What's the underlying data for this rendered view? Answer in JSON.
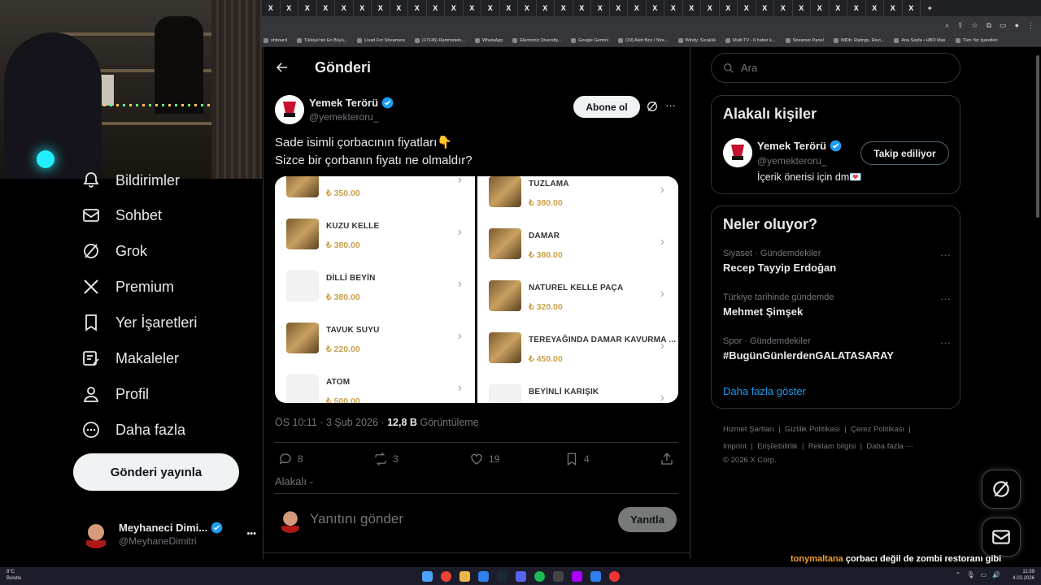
{
  "browser": {
    "tab_glyph": "X",
    "new_tab": "+",
    "bookmarks": [
      "shboard",
      "Türkiye'nin En Büyü...",
      "Livad For Streamers",
      "(17145) Rammstein...",
      "WhatsApp",
      "Electronic Diversity...",
      "Google Gemini",
      "(19) Alert Box / Stre...",
      "Windy: Sıcaklık",
      "Multi TV - 6 haber k...",
      "Streamer Panel",
      "IMDb: Ratings, Revi...",
      "Ana Sayfa • HBO Max",
      "Tüm Yer İşaretleri"
    ]
  },
  "nav": {
    "items": [
      {
        "label": "Bildirimler",
        "icon": "bell-icon"
      },
      {
        "label": "Sohbet",
        "icon": "mail-icon"
      },
      {
        "label": "Grok",
        "icon": "grok-icon"
      },
      {
        "label": "Premium",
        "icon": "x-logo-icon"
      },
      {
        "label": "Yer İşaretleri",
        "icon": "bookmark-icon"
      },
      {
        "label": "Makaleler",
        "icon": "article-icon"
      },
      {
        "label": "Profil",
        "icon": "profile-icon"
      },
      {
        "label": "Daha fazla",
        "icon": "more-circle-icon"
      }
    ],
    "post_button": "Gönderi yayınla",
    "account": {
      "name": "Meyhaneci Dimi...",
      "handle": "@MeyhaneDimitri",
      "more": "•••"
    }
  },
  "post": {
    "header_title": "Gönderi",
    "author_name": "Yemek Terörü",
    "author_handle": "@yemekteroru_",
    "subscribe": "Abone ol",
    "text_line1": "Sade isimli çorbacının fiyatları👇",
    "text_line2": "Sizce bir çorbanın fiyatı ne olmaldır?",
    "menu_left": [
      {
        "name": "",
        "price": "₺ 350.00",
        "img": true
      },
      {
        "name": "KUZU KELLE",
        "price": "₺ 380.00",
        "img": true
      },
      {
        "name": "DİLLİ BEYİN",
        "price": "₺ 380.00",
        "img": false
      },
      {
        "name": "TAVUK SUYU",
        "price": "₺ 220.00",
        "img": true
      },
      {
        "name": "ATOM",
        "price": "₺ 500.00",
        "img": false
      }
    ],
    "menu_right": [
      {
        "name": "TUZLAMA",
        "price": "₺ 380.00",
        "img": true
      },
      {
        "name": "DAMAR",
        "price": "₺ 380.00",
        "img": true
      },
      {
        "name": "NATUREL KELLE PAÇA",
        "price": "₺ 320.00",
        "img": true
      },
      {
        "name": "TEREYAĞINDA DAMAR KAVURMA ...",
        "price": "₺ 450.00",
        "img": true
      },
      {
        "name": "BEYİNLİ KARIŞIK",
        "price": "",
        "img": false
      }
    ],
    "timestamp": "ÖS 10:11 · 3 Şub 2026 · ",
    "views_count": "12,8 B",
    "views_label": " Görüntüleme",
    "replies": "8",
    "reposts": "3",
    "likes": "19",
    "bookmarks": "4",
    "relevance": "Alakalı",
    "reply_placeholder": "Yanıtını gönder",
    "reply_button": "Yanıtla"
  },
  "sidebar": {
    "search_placeholder": "Ara",
    "related_title": "Alakalı kişiler",
    "related": {
      "name": "Yemek Terörü",
      "handle": "@yemekteroru_",
      "bio": "İçerik önerisi için dm💌",
      "follow_button": "Takip ediliyor"
    },
    "trends_title": "Neler oluyor?",
    "trends": [
      {
        "context": "Siyaset · Gündemdekiler",
        "name": "Recep Tayyip Erdoğan"
      },
      {
        "context": "Türkiye tarihinde gündemde",
        "name": "Mehmet Şimşek"
      },
      {
        "context": "Spor · Gündemdekiler",
        "name": "#BugünGünlerdenGALATASARAY"
      }
    ],
    "show_more": "Daha fazla göster",
    "footer_row1": [
      "Hizmet Şartları",
      "Gizlilik Politikası",
      "Çerez Politikası"
    ],
    "footer_row2": [
      "Imprint",
      "Erişilebilirlik",
      "Reklam bilgisi",
      "Daha fazla ···"
    ],
    "copyright": "© 2026 X Corp."
  },
  "chat": {
    "user": "tonymaltana",
    "message": " çorbacı değil de zombi restoranı gibi şunlara bak"
  },
  "taskbar": {
    "temp": "8°C",
    "weather": "Bulutlu",
    "time": "11:59",
    "date": "4.02.2026"
  },
  "colors": {
    "accent": "#1d9bf0",
    "menu_price": "#c9a24d",
    "background": "#000000",
    "border": "#2f3336"
  }
}
